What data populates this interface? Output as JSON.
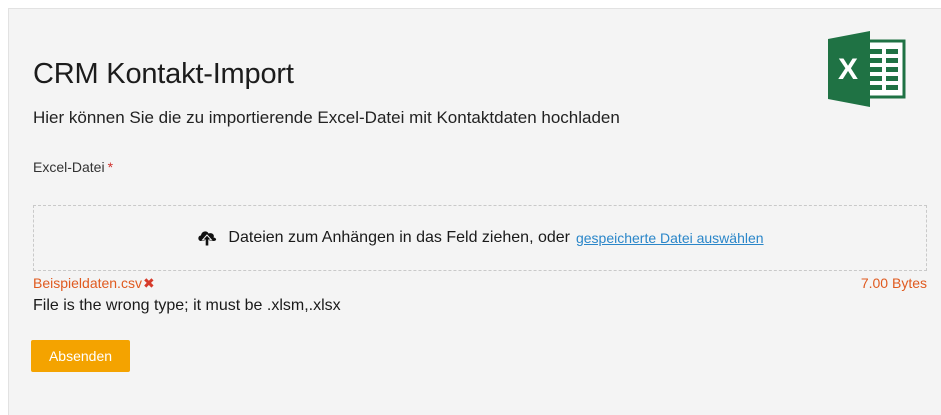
{
  "header": {
    "title": "CRM Kontakt-Import",
    "subtitle": "Hier können Sie die zu importierende Excel-Datei mit Kontaktdaten hochladen",
    "logo_icon": "excel-logo-icon",
    "logo_letter": "X"
  },
  "field": {
    "label": "Excel-Datei",
    "required_marker": "*"
  },
  "dropzone": {
    "icon": "cloud-upload-icon",
    "text": "Dateien zum Anhängen in das Feld ziehen, oder",
    "link_text": "gespeicherte Datei auswählen"
  },
  "file": {
    "name": "Beispieldaten.csv",
    "remove_icon": "✖",
    "size": "7.00 Bytes",
    "error": "File is the wrong type; it must be .xlsm,.xlsx"
  },
  "actions": {
    "submit_label": "Absenden"
  },
  "colors": {
    "accent": "#f4a300",
    "error": "#e05a1f",
    "link": "#2a86c9",
    "excel_green": "#1f7244"
  }
}
